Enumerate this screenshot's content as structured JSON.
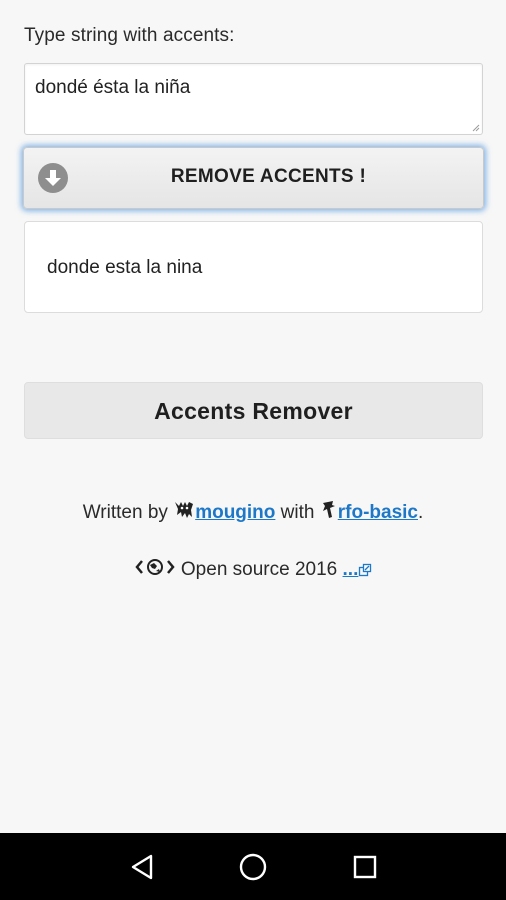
{
  "input": {
    "label": "Type string with accents:",
    "value": "dondé ésta la niña"
  },
  "action_button": {
    "label": "REMOVE ACCENTS !",
    "icon": "arrow-down-circle-icon"
  },
  "output": {
    "text": "donde esta la nina"
  },
  "app_title": "Accents Remover",
  "credits": {
    "prefix": "Written by",
    "author": "mougino",
    "author_icon": "author-logo-icon",
    "middle": "with",
    "tool": "rfo-basic",
    "tool_icon": "rfo-logo-icon",
    "suffix": "."
  },
  "opensource": {
    "text": "Open source 2016",
    "link": "...",
    "icon": "code-globe-icon",
    "link_icon": "external-link-icon"
  },
  "navbar": {
    "back_icon": "back-triangle-icon",
    "home_icon": "home-circle-icon",
    "recent_icon": "recent-square-icon"
  },
  "colors": {
    "background": "#f7f7f7",
    "link": "#1e78c8",
    "focus_glow": "#5c9de2",
    "navbar": "#000000"
  }
}
